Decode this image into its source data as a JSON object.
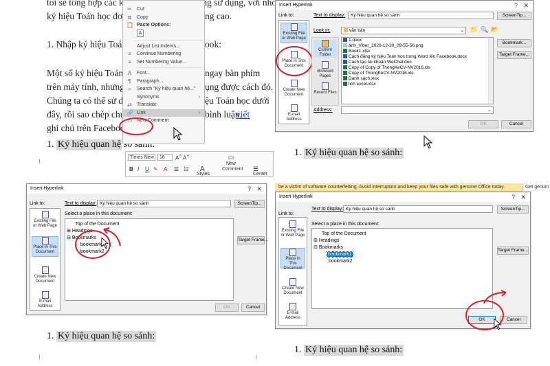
{
  "q1": {
    "doc_line1": "tôi sẽ tổng hợp các ký hiệu Toán học thường sử dụng, với nhóm",
    "doc_line2": "ký hiệu Toán học đơn",
    "doc_line2_end": "ng cao.",
    "doc_line3": "1. Nhập ký hiệu Toán",
    "doc_line3_end": "ook:",
    "doc_p1": "Một số ký hiệu Toán h",
    "doc_p1_end": "ngay bàn phím",
    "doc_p2": "trên máy tính, nhưng p",
    "doc_p2_end": "ụng được cách đó.",
    "doc_p3": "Chúng ta có thể sử dụ",
    "doc_p3_end": "ệu Toán học dưới",
    "doc_p4": "đây, rồi sao chép chún",
    "doc_p4_end": "bình luận,",
    "doc_p4_link": "viết",
    "doc_p5": "ghi chú trên Facebook",
    "heading_num": "1.",
    "heading_text": "Ký hiệu quan hệ so sánh:",
    "context_menu": {
      "cut": "Cut",
      "copy": "Copy",
      "paste_options": "Paste Options:",
      "paste_a": "A",
      "adjust": "Adjust List Indents...",
      "continue": "Continue Numbering",
      "set_value": "Set Numbering Value...",
      "font": "Font...",
      "paragraph": "Paragraph...",
      "search": "Search \"Ký hiệu quan hệ...\"",
      "synonyms": "Synonyms",
      "translate": "Translate",
      "link": "Link",
      "new_comment": "New Comment"
    },
    "format_bar": {
      "font": "Times New",
      "size": "16",
      "styles": "Styles",
      "new_comment": "New Comment",
      "center": "Center"
    }
  },
  "q2": {
    "title": "Insert Hyperlink",
    "link_to": "Link to:",
    "text_to_display_label": "Text to display:",
    "text_to_display": "Ký hiệu quan hệ so sánh",
    "screentip": "ScreenTip...",
    "look_in_label": "Look in:",
    "look_in": "văn bản",
    "link_items": [
      "Existing File or Web Page",
      "Place in This Document",
      "Create New Document",
      "E-mail Address"
    ],
    "side_items": [
      "Current Folder",
      "Browsed Pages",
      "Recent Files"
    ],
    "files": [
      {
        "name": "1.docx",
        "type": "w"
      },
      {
        "name": "ảnh_Viber_2020-12-30_09-55-56.png",
        "type": "p"
      },
      {
        "name": "Book1.xlsx",
        "type": "x"
      },
      {
        "name": "Cách đăng ký hiệu Toán học trong Word lên Facebook.docx",
        "type": "w"
      },
      {
        "name": "Cách tạo tài khoản WeChat.doc",
        "type": "w"
      },
      {
        "name": "Copy of Copy of ThongKeCV-NV2016.xls",
        "type": "x"
      },
      {
        "name": "Copy of ThongKeCV-NV2016.xls",
        "type": "x"
      },
      {
        "name": "Danh sách.xlsx",
        "type": "x"
      },
      {
        "name": "lich excel.xlsx",
        "type": "x"
      }
    ],
    "bookmark": "Bookmark...",
    "target_frame": "Target Frame...",
    "address_label": "Address:",
    "ok": "OK",
    "cancel": "Cancel",
    "heading_num": "1.",
    "heading_text": "Ký hiệu quan hệ so sánh:"
  },
  "q3": {
    "title": "Insert Hyperlink",
    "link_to": "Link to:",
    "text_to_display_label": "Text to display:",
    "text_to_display": "Ký hiệu quan hệ so sánh",
    "screentip": "ScreenTip...",
    "select_place": "Select a place in this document:",
    "tree": [
      "Top of the Document",
      "Headings",
      "Bookmarks",
      "bookmark1",
      "bookmark2"
    ],
    "target_frame": "Target Frame...",
    "link_items": [
      "Existing File or Web Page",
      "Place in This Document",
      "Create New Document",
      "E-mail Address"
    ],
    "ok": "OK",
    "cancel": "Cancel",
    "heading_num": "1.",
    "heading_text": "Ký hiệu quan hệ so sánh:"
  },
  "q4": {
    "banner": "be a victim of software counterfeiting. Avoid interruption and keep your files safe with genuine Office today.",
    "banner_get": "Get genuin",
    "title": "Insert Hyperlink",
    "link_to": "Link to:",
    "text_to_display_label": "Text to display:",
    "text_to_display": "Ký hiệu quan hệ so sánh",
    "screentip": "ScreenTip...",
    "select_place": "Select a place in this document:",
    "tree": [
      "Top of the Document",
      "Headings",
      "Bookmarks",
      "bookmark1",
      "bookmark2"
    ],
    "target_frame": "Target Frame...",
    "link_items": [
      "Existing File or Web Page",
      "Place in This Document",
      "Create New Document",
      "E-mail Address"
    ],
    "ok": "OK",
    "cancel": "Cancel",
    "heading_num": "1.",
    "heading_text": "Ký hiệu quan hệ so sánh:"
  },
  "colors": {
    "annotation": "#d9202a",
    "selection": "#0078d7",
    "heading_bg": "#d9d9d9"
  }
}
